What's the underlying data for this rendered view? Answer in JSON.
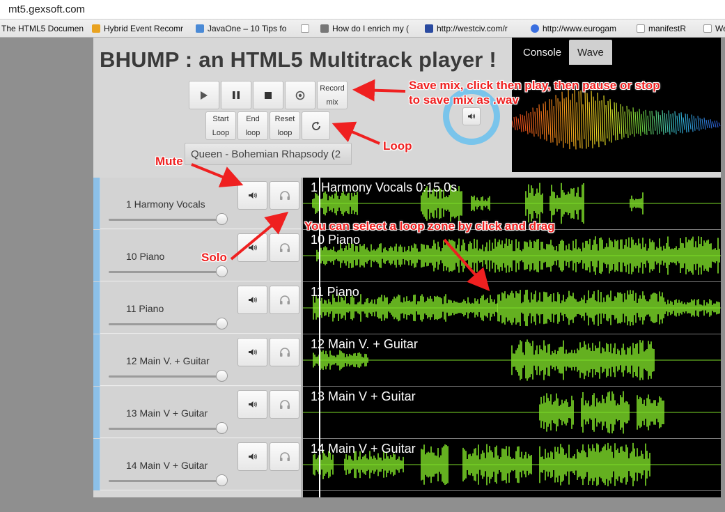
{
  "browser": {
    "url": "mt5.gexsoft.com",
    "bookmarks": [
      {
        "label": "The HTML5 Documen",
        "color": "#ffffff"
      },
      {
        "label": "Hybrid Event Recomr",
        "color": "#e9a321"
      },
      {
        "label": "JavaOne – 10 Tips fo",
        "color": "#4a8ad6"
      },
      {
        "label": "",
        "color": "#ffffff"
      },
      {
        "label": "How do I enrich my (",
        "color": "#777777"
      },
      {
        "label": "http://westciv.com/r",
        "color": "#2a4aa0"
      },
      {
        "label": "http://www.eurogam",
        "color": "#3a6fe0"
      },
      {
        "label": "manifestR",
        "color": "#ffffff"
      },
      {
        "label": "We",
        "color": "#ffffff"
      }
    ]
  },
  "app": {
    "title": "BHUMP : an HTML5 Multitrack player !",
    "transport": {
      "play_icon": "play-icon",
      "pause_icon": "pause-icon",
      "stop_icon": "stop-icon",
      "record_icon": "record-icon",
      "record_mix_line1": "Record",
      "record_mix_line2": "mix",
      "start_loop_line1": "Start",
      "start_loop_line2": "Loop",
      "end_loop_line1": "End",
      "end_loop_line2": "loop",
      "reset_loop_line1": "Reset",
      "reset_loop_line2": "loop",
      "refresh_icon": "refresh-icon"
    },
    "song": "Queen - Bohemian Rhapsody (2",
    "tabs": [
      {
        "label": "Console",
        "active": false
      },
      {
        "label": "Wave",
        "active": true
      }
    ],
    "tracks": [
      {
        "name": "1 Harmony Vocals",
        "wave_label": "1 Harmony Vocals  0:15.0s",
        "volume": 1.0
      },
      {
        "name": "10 Piano",
        "wave_label": "10 Piano",
        "volume": 1.0
      },
      {
        "name": "11 Piano",
        "wave_label": "11 Piano",
        "volume": 1.0
      },
      {
        "name": "12 Main V. + Guitar",
        "wave_label": "12 Main V. + Guitar",
        "volume": 1.0
      },
      {
        "name": "13 Main V + Guitar",
        "wave_label": "13 Main V + Guitar",
        "volume": 1.0
      },
      {
        "name": "14 Main V + Guitar",
        "wave_label": "14 Main V + Guitar",
        "volume": 1.0
      }
    ],
    "colors": {
      "wave": "#7ddc28",
      "accent": "#8cc0e8",
      "annotation": "#ef2020"
    }
  },
  "annotations": {
    "save_mix": "Save mix, click then play, then pause or stop",
    "save_mix_2": "to save mix as .wav",
    "loop": "Loop",
    "mute": "Mute",
    "solo": "Solo",
    "loop_zone": "You can select a loop zone by click and drag"
  }
}
